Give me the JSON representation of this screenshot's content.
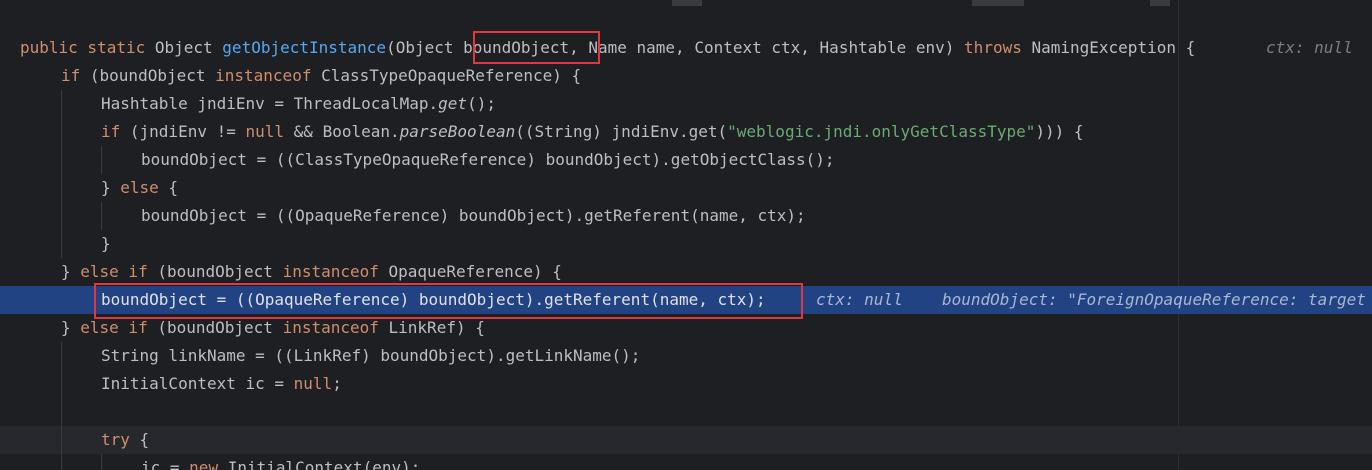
{
  "editor": {
    "lines": [
      {
        "type": "sig",
        "text": {
          "kw1": "public static ",
          "type1": "Object ",
          "method": "getObjectInstance",
          "p_open": "(Object ",
          "param1": "boundObject",
          "rest": ", Name name, Context ctx, Hashtable env) ",
          "throws": "throws",
          "exc": " NamingException {"
        },
        "hint": "ctx: null"
      },
      {
        "type": "if1",
        "text": {
          "kw_if": "if",
          "p1": " (boundObject ",
          "kw_inst": "instanceof",
          "p2": " ClassTypeOpaqueReference) {"
        }
      },
      {
        "type": "env",
        "text": {
          "p1": "Hashtable jndiEnv = ThreadLocalMap.",
          "m": "get",
          "p2": "();"
        }
      },
      {
        "type": "if2",
        "text": {
          "kw_if": "if",
          "p1": " (jndiEnv != ",
          "kw_null": "null",
          "p2": " && Boolean.",
          "m": "parseBoolean",
          "p3": "((String) jndiEnv.get(",
          "str": "\"weblogic.jndi.onlyGetClassType\"",
          "p4": "))) {"
        }
      },
      {
        "type": "plain",
        "text": "boundObject = ((ClassTypeOpaqueReference) boundObject).getObjectClass();"
      },
      {
        "type": "else1",
        "text": {
          "p1": "} ",
          "kw_else": "else",
          "p2": " {"
        }
      },
      {
        "type": "plain",
        "text": "boundObject = ((OpaqueReference) boundObject).getReferent(name, ctx);"
      },
      {
        "type": "plain",
        "text": "}"
      },
      {
        "type": "elseif1",
        "text": {
          "p1": "} ",
          "kw_else": "else if",
          "p2": " (boundObject ",
          "kw_inst": "instanceof",
          "p3": " OpaqueReference) {"
        }
      },
      {
        "type": "highlight",
        "text": "boundObject = ((OpaqueReference) boundObject).getReferent(name, ctx);",
        "hint1": "ctx: null",
        "hint2": "boundObject: \"ForeignOpaqueReference: target"
      },
      {
        "type": "elseif2",
        "text": {
          "p1": "} ",
          "kw_else": "else if",
          "p2": " (boundObject ",
          "kw_inst": "instanceof",
          "p3": " LinkRef) {"
        }
      },
      {
        "type": "plain",
        "text": "String linkName = ((LinkRef) boundObject).getLinkName();"
      },
      {
        "type": "nullassign",
        "text": {
          "p1": "InitialContext ic = ",
          "kw_null": "null",
          "p2": ";"
        }
      },
      {
        "type": "blank",
        "text": ""
      },
      {
        "type": "try",
        "text": {
          "kw_try": "try",
          "p1": " {"
        }
      },
      {
        "type": "newctx",
        "text": {
          "p1": "ic = ",
          "kw_new": "new",
          "p2": " InitialContext(env);"
        }
      }
    ]
  }
}
